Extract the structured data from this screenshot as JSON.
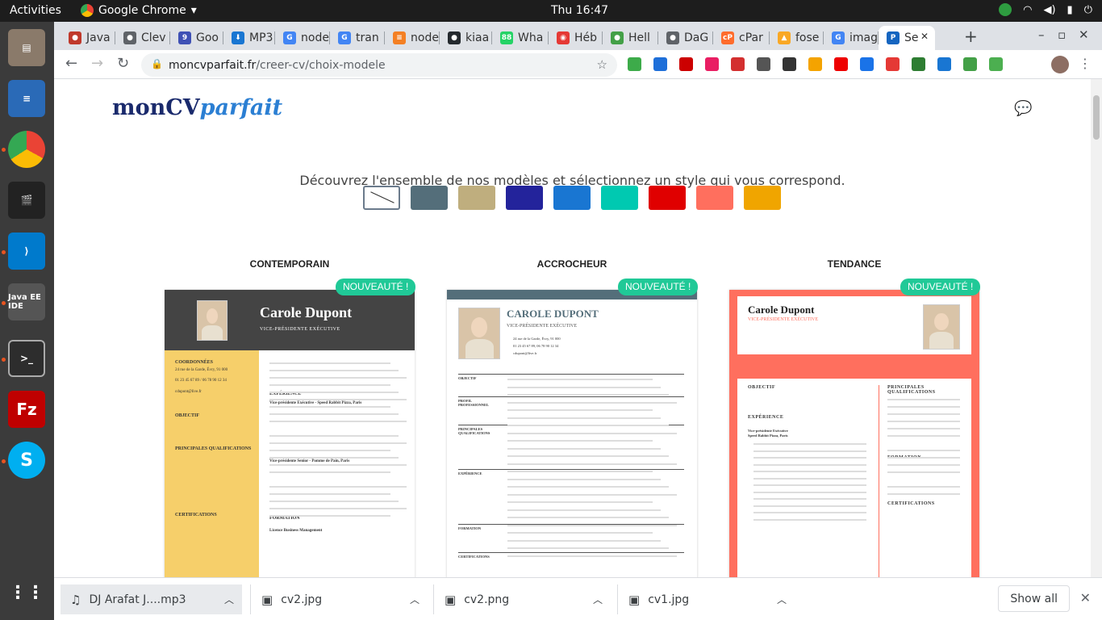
{
  "topbar": {
    "activities": "Activities",
    "app": "Google Chrome",
    "clock": "Thu 16:47"
  },
  "tabs": [
    {
      "label": "Java",
      "color": "#c0392b",
      "glyph": "●"
    },
    {
      "label": "Clev",
      "color": "#5f6368",
      "glyph": "●"
    },
    {
      "label": "Goo",
      "color": "#3f51b5",
      "glyph": "9"
    },
    {
      "label": "MP3",
      "color": "#1976d2",
      "glyph": "⬇"
    },
    {
      "label": "node",
      "color": "#4285f4",
      "glyph": "G"
    },
    {
      "label": "tran",
      "color": "#4285f4",
      "glyph": "G"
    },
    {
      "label": "node",
      "color": "#f48024",
      "glyph": "≡"
    },
    {
      "label": "kiaa",
      "color": "#24292e",
      "glyph": "●"
    },
    {
      "label": "Wha",
      "color": "#25d366",
      "glyph": "88"
    },
    {
      "label": "Héb",
      "color": "#e53935",
      "glyph": "◉"
    },
    {
      "label": "Hell",
      "color": "#43a047",
      "glyph": "●"
    },
    {
      "label": "DaG",
      "color": "#5f6368",
      "glyph": "●"
    },
    {
      "label": "cPar",
      "color": "#ff6c2c",
      "glyph": "cP"
    },
    {
      "label": "fose",
      "color": "#f9a825",
      "glyph": "▲"
    },
    {
      "label": "imag",
      "color": "#4285f4",
      "glyph": "G"
    },
    {
      "label": "Se",
      "color": "#1565c0",
      "glyph": "P"
    }
  ],
  "url": {
    "domain": "moncvparfait.fr",
    "path": "/creer-cv/choix-modele"
  },
  "page": {
    "logo_main": "monCV",
    "logo_accent": "parfait",
    "subtitle": "Découvrez l'ensemble de nos modèles et sélectionnez un style qui vous correspond.",
    "swatches": [
      "none",
      "#546e7a",
      "#bfae7e",
      "#23239b",
      "#1976d2",
      "#00c9b1",
      "#e00000",
      "#ff6f5e",
      "#f0a500"
    ],
    "badge": "NOUVEAUTÉ !",
    "templates": [
      {
        "title": "CONTEMPORAIN",
        "name": "Carole Dupont",
        "role": "VICE-PRÉSIDENTE EXÉCUTIVE",
        "side": [
          "COORDONNÉES",
          "24 rue de la Garde, Évry, 91 000",
          "01 23 45 67 89 / 06 78 90 12 34",
          "cdupont@live.fr",
          "OBJECTIF",
          "PRINCIPALES QUALIFICATIONS",
          "CERTIFICATIONS"
        ],
        "main": [
          "EXPÉRIENCE",
          "Vice-présidente Exécutive - Speed Rabbit Pizza, Paris",
          "Vice-présidente Senior - Pomme de Pain, Paris",
          "FORMATION",
          "Licence Business Management"
        ]
      },
      {
        "title": "ACCROCHEUR",
        "name": "CAROLE DUPONT",
        "role": "VICE-PRÉSIDENTE EXÉCUTIVE",
        "side": [
          "24 rue de la Garde, Évry, 91 000",
          "01 23 45 67 89, 06 78 90 12 34",
          "cdupont@live.fr"
        ],
        "main": [
          "OBJECTIF",
          "PROFIL PROFESSIONNEL",
          "PRINCIPALES QUALIFICATIONS",
          "EXPÉRIENCE",
          "FORMATION",
          "CERTIFICATIONS"
        ]
      },
      {
        "title": "TENDANCE",
        "name": "Carole Dupont",
        "role": "VICE-PRÉSIDENTE EXÉCUTIVE",
        "side": [
          "PRINCIPALES QUALIFICATIONS",
          "FORMATION",
          "CERTIFICATIONS"
        ],
        "main": [
          "OBJECTIF",
          "EXPÉRIENCE",
          "Vice-présidente Exécutive",
          "Speed Rabbit Pizza, Paris"
        ]
      }
    ]
  },
  "downloads": [
    {
      "name": "DJ Arafat J....mp3"
    },
    {
      "name": "cv2.jpg"
    },
    {
      "name": "cv2.png"
    },
    {
      "name": "cv1.jpg"
    }
  ],
  "downloads_show_all": "Show all"
}
